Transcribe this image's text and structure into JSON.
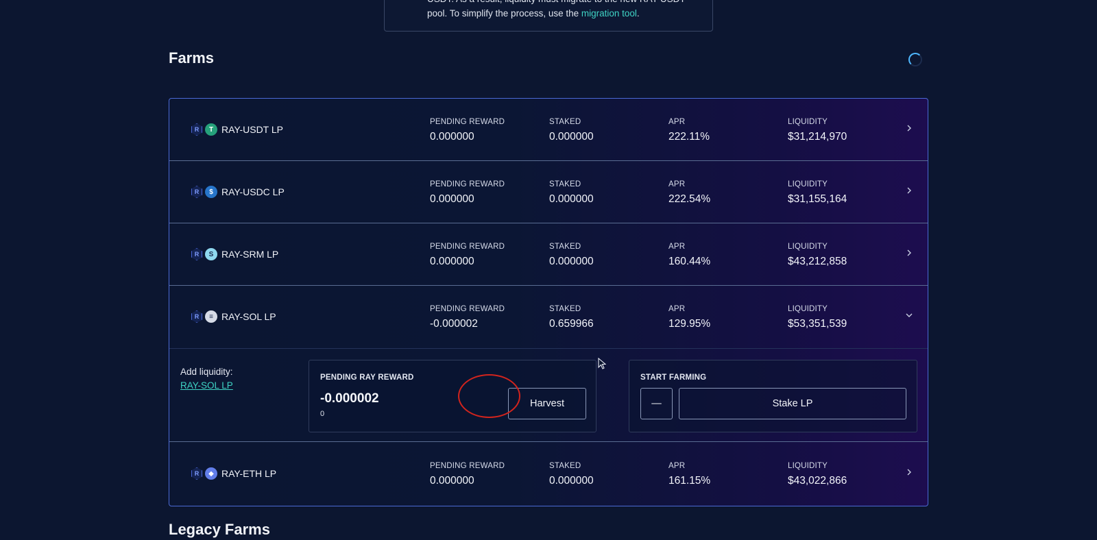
{
  "notice": {
    "line1": "USDT. As a result, liquidity must migrate to the new RAY-USDT",
    "line2_prefix": "pool. To simplify the process, use the ",
    "line2_link": "migration tool",
    "line2_suffix": "."
  },
  "farms_title": "Farms",
  "legacy_title": "Legacy Farms",
  "labels": {
    "pending_reward": "PENDING REWARD",
    "staked": "STAKED",
    "apr": "APR",
    "liquidity": "LIQUIDITY"
  },
  "farms": [
    {
      "name": "RAY-USDT LP",
      "pending_reward": "0.000000",
      "staked": "0.000000",
      "apr": "222.11%",
      "liquidity": "$31,214,970",
      "token_icon": "usdt-icon",
      "token_color": "#26a17b",
      "token_glyph": "T"
    },
    {
      "name": "RAY-USDC LP",
      "pending_reward": "0.000000",
      "staked": "0.000000",
      "apr": "222.54%",
      "liquidity": "$31,155,164",
      "token_icon": "usdc-icon",
      "token_color": "#2775ca",
      "token_glyph": "$"
    },
    {
      "name": "RAY-SRM LP",
      "pending_reward": "0.000000",
      "staked": "0.000000",
      "apr": "160.44%",
      "liquidity": "$43,212,858",
      "token_icon": "srm-icon",
      "token_color": "#8fd8ef",
      "token_glyph": "S"
    },
    {
      "name": "RAY-SOL LP",
      "pending_reward": "-0.000002",
      "staked": "0.659966",
      "apr": "129.95%",
      "liquidity": "$53,351,539",
      "token_icon": "sol-icon",
      "token_color": "#d6dbe7",
      "token_glyph": "≡"
    },
    {
      "name": "RAY-ETH LP",
      "pending_reward": "0.000000",
      "staked": "0.000000",
      "apr": "161.15%",
      "liquidity": "$43,022,866",
      "token_icon": "eth-icon",
      "token_color": "#627eea",
      "token_glyph": "◆"
    }
  ],
  "expanded": {
    "add_liquidity_label": "Add liquidity:",
    "add_liquidity_link": "RAY-SOL LP",
    "pending_title": "PENDING RAY REWARD",
    "pending_value": "-0.000002",
    "pending_sub": "0",
    "harvest_label": "Harvest",
    "start_farming_title": "START FARMING",
    "unstake_label": "—",
    "stake_label": "Stake LP"
  },
  "colors": {
    "accent_teal": "#3fd4c5",
    "annotation_red": "#d2241d",
    "border_blue": "#4b6ad6"
  }
}
